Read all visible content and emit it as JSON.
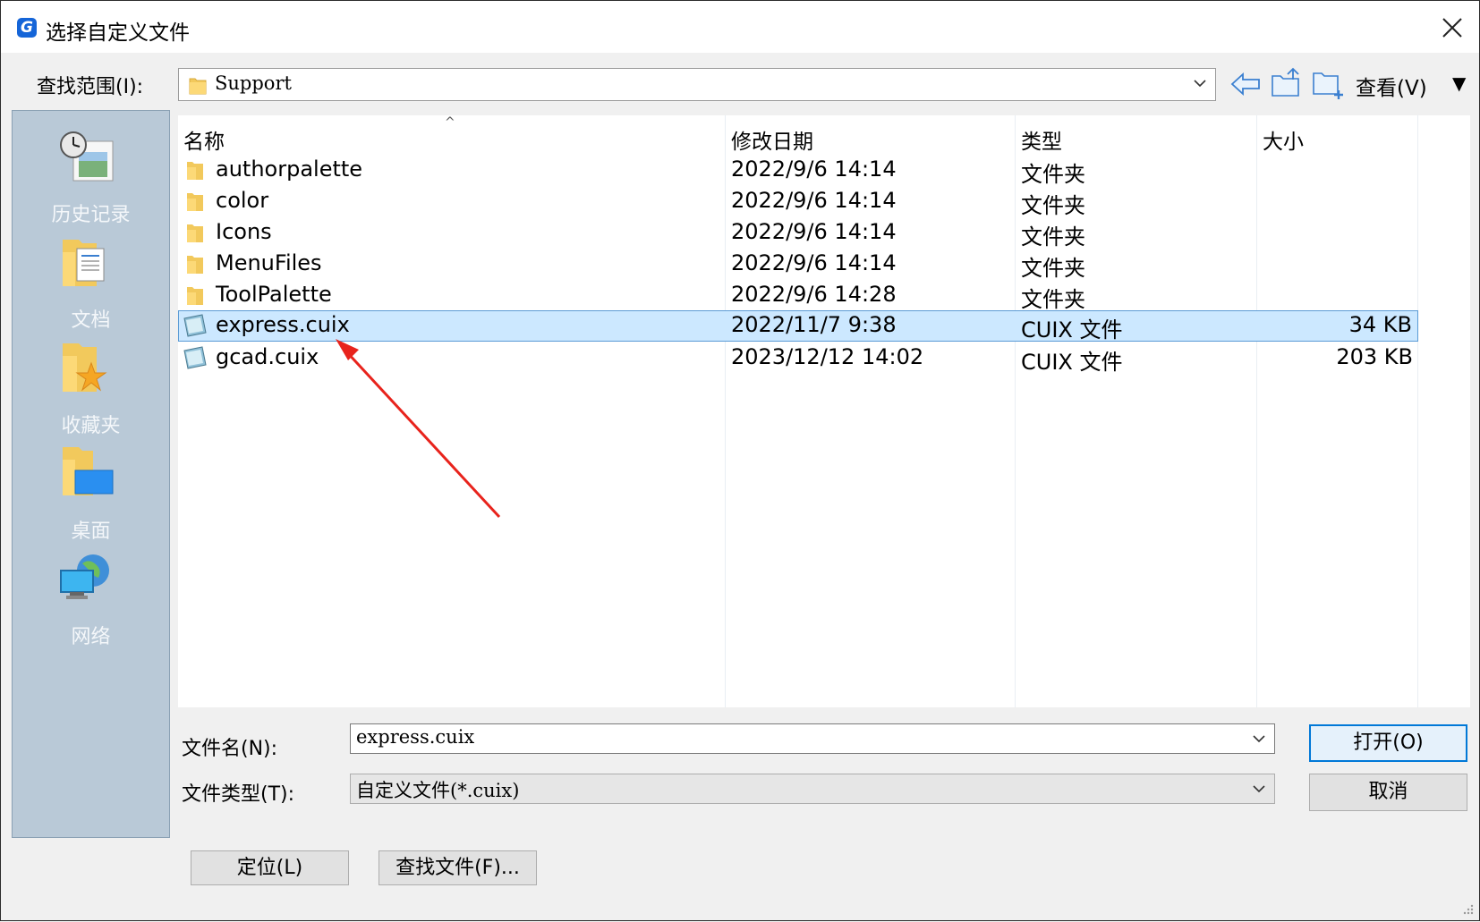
{
  "window": {
    "title": "选择自定义文件",
    "app_logo_letter": "G",
    "accent_color": "#0078d7"
  },
  "toolbar": {
    "lookin_label": "查找范围(I):",
    "lookin_value": "Support",
    "view_label": "查看(V)",
    "view_menu_arrow": "▼"
  },
  "places": [
    {
      "label": "历史记录",
      "icon": "history-icon"
    },
    {
      "label": "文档",
      "icon": "documents-icon"
    },
    {
      "label": "收藏夹",
      "icon": "favorites-icon"
    },
    {
      "label": "桌面",
      "icon": "desktop-icon"
    },
    {
      "label": "网络",
      "icon": "network-icon"
    }
  ],
  "filelist": {
    "columns": {
      "name": "名称",
      "modified": "修改日期",
      "type": "类型",
      "size": "大小"
    },
    "sort_indicator": "^",
    "rows": [
      {
        "name": "authorpalette",
        "modified": "2022/9/6 14:14",
        "type": "文件夹",
        "size": "",
        "icon": "folder-icon"
      },
      {
        "name": "color",
        "modified": "2022/9/6 14:14",
        "type": "文件夹",
        "size": "",
        "icon": "folder-icon"
      },
      {
        "name": "Icons",
        "modified": "2022/9/6 14:14",
        "type": "文件夹",
        "size": "",
        "icon": "folder-icon"
      },
      {
        "name": "MenuFiles",
        "modified": "2022/9/6 14:14",
        "type": "文件夹",
        "size": "",
        "icon": "folder-icon"
      },
      {
        "name": "ToolPalette",
        "modified": "2022/9/6 14:28",
        "type": "文件夹",
        "size": "",
        "icon": "folder-icon"
      },
      {
        "name": "express.cuix",
        "modified": "2022/11/7 9:38",
        "type": "CUIX 文件",
        "size": "34 KB",
        "icon": "cuix-file-icon",
        "selected": true
      },
      {
        "name": "gcad.cuix",
        "modified": "2023/12/12 14:02",
        "type": "CUIX 文件",
        "size": "203 KB",
        "icon": "cuix-file-icon"
      }
    ]
  },
  "bottom": {
    "filename_label": "文件名(N):",
    "filename_value": "express.cuix",
    "filetype_label": "文件类型(T):",
    "filetype_value": "自定义文件(*.cuix)",
    "open_button": "打开(O)",
    "cancel_button": "取消",
    "locate_button": "定位(L)",
    "find_button": "查找文件(F)..."
  },
  "annotation": {
    "color": "#e8231c"
  }
}
